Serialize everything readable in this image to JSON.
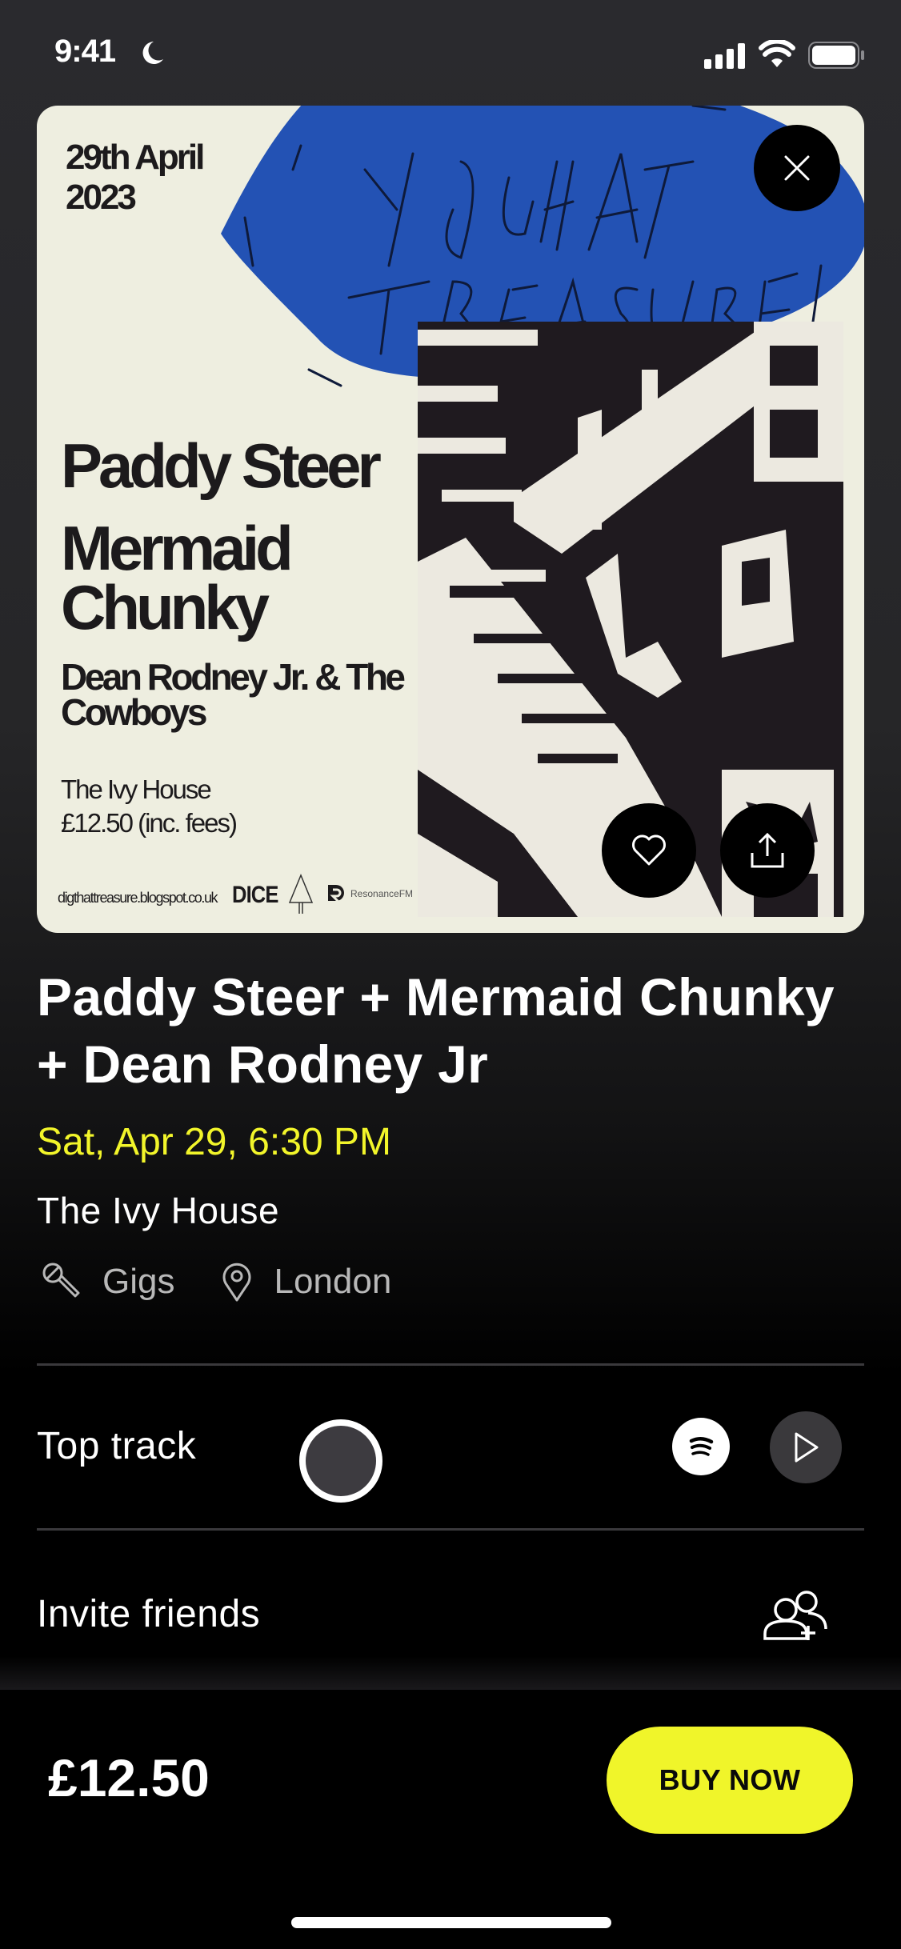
{
  "status_bar": {
    "time": "9:41"
  },
  "poster": {
    "date_line1": "29th April",
    "date_line2": "2023",
    "handwritten": "DIG THAT TREASURE!",
    "artist1": "Paddy Steer",
    "artist2": "Mermaid Chunky",
    "artist3": "Dean Rodney Jr. & The Cowboys",
    "venue": "The Ivy House",
    "price": "£12.50 (inc. fees)",
    "url": "digthattreasure.blogspot.co.uk",
    "sponsor_dice": "DICE",
    "sponsor_resonance": "ResonanceFM"
  },
  "event": {
    "title": "Paddy Steer + Mermaid Chunky + Dean Rodney Jr",
    "datetime": "Sat, Apr 29, 6:30 PM",
    "venue": "The Ivy House",
    "category": "Gigs",
    "city": "London"
  },
  "rows": {
    "top_track_label": "Top track",
    "invite_label": "Invite friends"
  },
  "footer": {
    "price": "£12.50",
    "buy_label": "BUY NOW"
  },
  "colors": {
    "accent": "#f0f52a",
    "poster_bg": "#eeeee0",
    "poster_blue": "#2352b4"
  }
}
